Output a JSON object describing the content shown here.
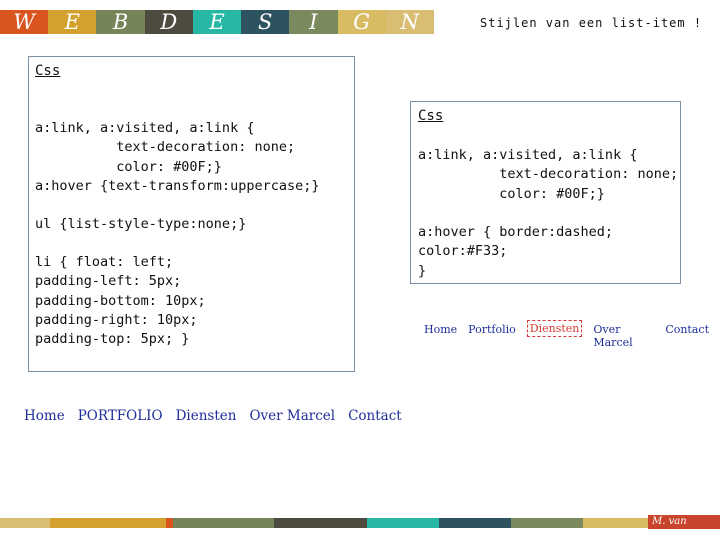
{
  "banner": {
    "letters": [
      {
        "char": "W",
        "color": "#d9541f"
      },
      {
        "char": "E",
        "color": "#d4a12f"
      },
      {
        "char": "B",
        "color": "#76845a"
      },
      {
        "char": "D",
        "color": "#4d4a40"
      },
      {
        "char": "E",
        "color": "#26b8a5"
      },
      {
        "char": "S",
        "color": "#2e5360"
      },
      {
        "char": "I",
        "color": "#7a8a5e"
      },
      {
        "char": "G",
        "color": "#d8bb63"
      },
      {
        "char": "N",
        "color": "#d8bd72"
      }
    ]
  },
  "slide_title": "Stijlen van een list-item !",
  "box1": {
    "heading": "Css",
    "code_block1": "a:link, a:visited, a:link {\n          text-decoration: none;\n          color: #00F;}\na:hover {text-transform:uppercase;}",
    "code_block2": "ul {list-style-type:none;}",
    "code_block3": "li { float: left;\npadding-left: 5px;\npadding-bottom: 10px;\npadding-right: 10px;\npadding-top: 5px; }"
  },
  "box2": {
    "heading": "Css",
    "code_block1": "a:link, a:visited, a:link {\n          text-decoration: none;\n          color: #00F;}",
    "code_block2": "a:hover { border:dashed;\ncolor:#F33;\n}"
  },
  "nav_uppercase": {
    "items": [
      "Home",
      "PORTFOLIO",
      "Diensten",
      "Over Marcel",
      "Contact"
    ]
  },
  "nav_dashed": {
    "items": [
      "Home",
      "Portfolio",
      "Diensten",
      "Over Marcel",
      "Contact"
    ],
    "hover_index": 2
  },
  "footer": {
    "author": "M. van Cinkel",
    "colors": [
      "#d9541f",
      "#d4a12f",
      "#76845a",
      "#4d4a40",
      "#26b8a5",
      "#2e5360",
      "#7a8a5e",
      "#d8bb63"
    ]
  }
}
